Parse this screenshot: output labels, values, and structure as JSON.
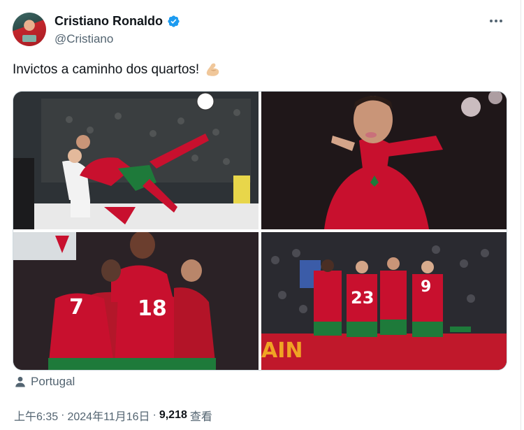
{
  "author": {
    "display_name": "Cristiano Ronaldo",
    "handle": "@Cristiano",
    "verified": true
  },
  "tweet": {
    "text": "Invictos a caminho dos quartos!",
    "emoji": "flexed-biceps-icon"
  },
  "media": {
    "photos": [
      {
        "jersey_number": ""
      },
      {
        "jersey_number": ""
      },
      {
        "jersey_number": "18"
      },
      {
        "jersey_number": "23",
        "banner_text": "AIN"
      }
    ]
  },
  "location": {
    "label": "Portugal"
  },
  "meta": {
    "time": "上午6:35",
    "separator1": "·",
    "date": "2024年11月16日",
    "separator2": "·",
    "views_count": "9,218",
    "views_label": "查看"
  },
  "colors": {
    "verified_blue": "#1d9bf0",
    "muted_text": "#536471",
    "primary_text": "#0f1419",
    "portugal_red": "#c8102e",
    "portugal_green": "#1e7a3a"
  }
}
